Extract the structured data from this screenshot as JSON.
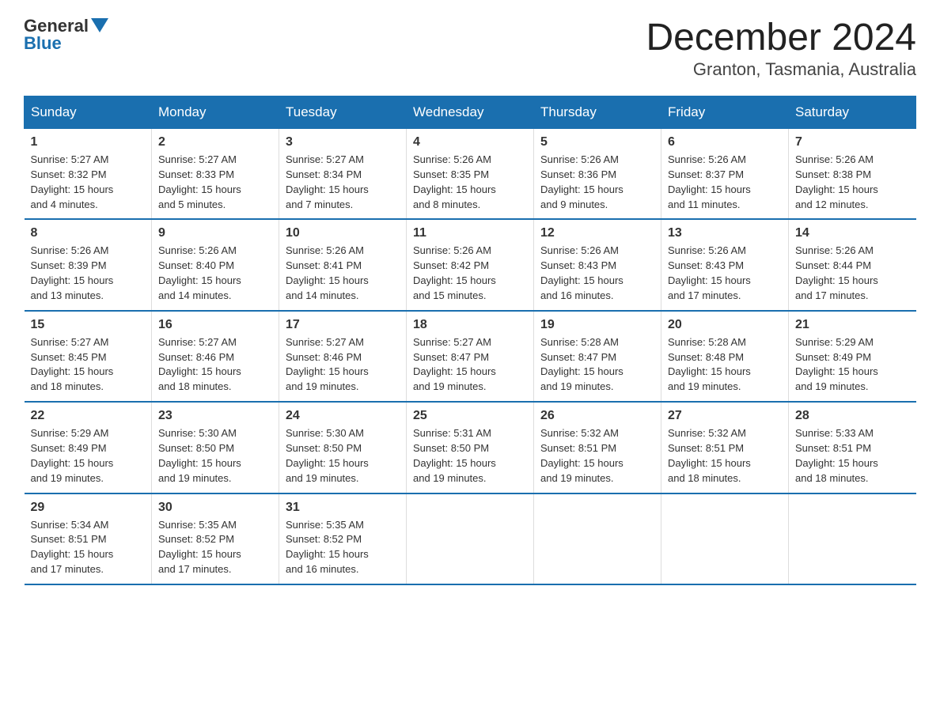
{
  "logo": {
    "general": "General",
    "blue": "Blue"
  },
  "title": "December 2024",
  "subtitle": "Granton, Tasmania, Australia",
  "days_of_week": [
    "Sunday",
    "Monday",
    "Tuesday",
    "Wednesday",
    "Thursday",
    "Friday",
    "Saturday"
  ],
  "weeks": [
    [
      {
        "day": "1",
        "sunrise": "5:27 AM",
        "sunset": "8:32 PM",
        "daylight": "15 hours and 4 minutes."
      },
      {
        "day": "2",
        "sunrise": "5:27 AM",
        "sunset": "8:33 PM",
        "daylight": "15 hours and 5 minutes."
      },
      {
        "day": "3",
        "sunrise": "5:27 AM",
        "sunset": "8:34 PM",
        "daylight": "15 hours and 7 minutes."
      },
      {
        "day": "4",
        "sunrise": "5:26 AM",
        "sunset": "8:35 PM",
        "daylight": "15 hours and 8 minutes."
      },
      {
        "day": "5",
        "sunrise": "5:26 AM",
        "sunset": "8:36 PM",
        "daylight": "15 hours and 9 minutes."
      },
      {
        "day": "6",
        "sunrise": "5:26 AM",
        "sunset": "8:37 PM",
        "daylight": "15 hours and 11 minutes."
      },
      {
        "day": "7",
        "sunrise": "5:26 AM",
        "sunset": "8:38 PM",
        "daylight": "15 hours and 12 minutes."
      }
    ],
    [
      {
        "day": "8",
        "sunrise": "5:26 AM",
        "sunset": "8:39 PM",
        "daylight": "15 hours and 13 minutes."
      },
      {
        "day": "9",
        "sunrise": "5:26 AM",
        "sunset": "8:40 PM",
        "daylight": "15 hours and 14 minutes."
      },
      {
        "day": "10",
        "sunrise": "5:26 AM",
        "sunset": "8:41 PM",
        "daylight": "15 hours and 14 minutes."
      },
      {
        "day": "11",
        "sunrise": "5:26 AM",
        "sunset": "8:42 PM",
        "daylight": "15 hours and 15 minutes."
      },
      {
        "day": "12",
        "sunrise": "5:26 AM",
        "sunset": "8:43 PM",
        "daylight": "15 hours and 16 minutes."
      },
      {
        "day": "13",
        "sunrise": "5:26 AM",
        "sunset": "8:43 PM",
        "daylight": "15 hours and 17 minutes."
      },
      {
        "day": "14",
        "sunrise": "5:26 AM",
        "sunset": "8:44 PM",
        "daylight": "15 hours and 17 minutes."
      }
    ],
    [
      {
        "day": "15",
        "sunrise": "5:27 AM",
        "sunset": "8:45 PM",
        "daylight": "15 hours and 18 minutes."
      },
      {
        "day": "16",
        "sunrise": "5:27 AM",
        "sunset": "8:46 PM",
        "daylight": "15 hours and 18 minutes."
      },
      {
        "day": "17",
        "sunrise": "5:27 AM",
        "sunset": "8:46 PM",
        "daylight": "15 hours and 19 minutes."
      },
      {
        "day": "18",
        "sunrise": "5:27 AM",
        "sunset": "8:47 PM",
        "daylight": "15 hours and 19 minutes."
      },
      {
        "day": "19",
        "sunrise": "5:28 AM",
        "sunset": "8:47 PM",
        "daylight": "15 hours and 19 minutes."
      },
      {
        "day": "20",
        "sunrise": "5:28 AM",
        "sunset": "8:48 PM",
        "daylight": "15 hours and 19 minutes."
      },
      {
        "day": "21",
        "sunrise": "5:29 AM",
        "sunset": "8:49 PM",
        "daylight": "15 hours and 19 minutes."
      }
    ],
    [
      {
        "day": "22",
        "sunrise": "5:29 AM",
        "sunset": "8:49 PM",
        "daylight": "15 hours and 19 minutes."
      },
      {
        "day": "23",
        "sunrise": "5:30 AM",
        "sunset": "8:50 PM",
        "daylight": "15 hours and 19 minutes."
      },
      {
        "day": "24",
        "sunrise": "5:30 AM",
        "sunset": "8:50 PM",
        "daylight": "15 hours and 19 minutes."
      },
      {
        "day": "25",
        "sunrise": "5:31 AM",
        "sunset": "8:50 PM",
        "daylight": "15 hours and 19 minutes."
      },
      {
        "day": "26",
        "sunrise": "5:32 AM",
        "sunset": "8:51 PM",
        "daylight": "15 hours and 19 minutes."
      },
      {
        "day": "27",
        "sunrise": "5:32 AM",
        "sunset": "8:51 PM",
        "daylight": "15 hours and 18 minutes."
      },
      {
        "day": "28",
        "sunrise": "5:33 AM",
        "sunset": "8:51 PM",
        "daylight": "15 hours and 18 minutes."
      }
    ],
    [
      {
        "day": "29",
        "sunrise": "5:34 AM",
        "sunset": "8:51 PM",
        "daylight": "15 hours and 17 minutes."
      },
      {
        "day": "30",
        "sunrise": "5:35 AM",
        "sunset": "8:52 PM",
        "daylight": "15 hours and 17 minutes."
      },
      {
        "day": "31",
        "sunrise": "5:35 AM",
        "sunset": "8:52 PM",
        "daylight": "15 hours and 16 minutes."
      },
      null,
      null,
      null,
      null
    ]
  ],
  "labels": {
    "sunrise": "Sunrise:",
    "sunset": "Sunset:",
    "daylight": "Daylight:"
  }
}
